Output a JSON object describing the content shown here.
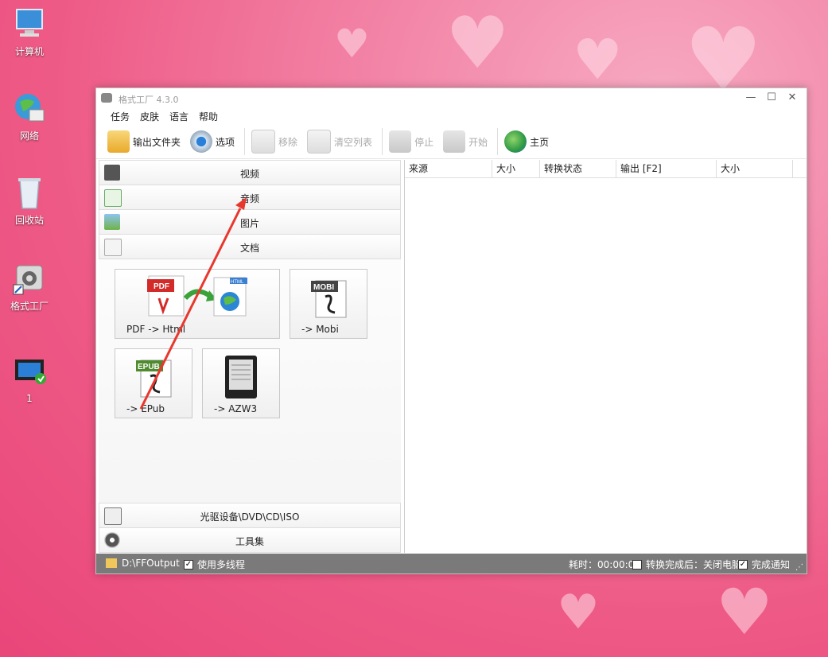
{
  "desktop": {
    "icons": [
      {
        "label": "计算机"
      },
      {
        "label": "网络"
      },
      {
        "label": "回收站"
      },
      {
        "label": "格式工厂"
      },
      {
        "label": "1"
      }
    ]
  },
  "window": {
    "title": "格式工厂 4.3.0",
    "menu": [
      "任务",
      "皮肤",
      "语言",
      "帮助"
    ],
    "toolbar": {
      "output_folder": "输出文件夹",
      "options": "选项",
      "remove": "移除",
      "clear_list": "清空列表",
      "stop": "停止",
      "start": "开始",
      "home": "主页"
    },
    "categories": {
      "video": "视频",
      "audio": "音频",
      "image": "图片",
      "document": "文档",
      "optical": "光驱设备\\DVD\\CD\\ISO",
      "tools": "工具集"
    },
    "tiles": [
      {
        "label": "PDF -> Html",
        "badge": "PDF",
        "badge2": "HTML"
      },
      {
        "label": "-> Mobi",
        "badge": "MOBI"
      },
      {
        "label": "-> EPub",
        "badge": "EPUB"
      },
      {
        "label": "-> AZW3"
      }
    ],
    "columns": [
      "来源",
      "大小",
      "转换状态",
      "输出 [F2]",
      "大小"
    ],
    "status": {
      "output_path": "D:\\FFOutput",
      "multithread": "使用多线程",
      "elapsed": "耗时：00:00:00",
      "after_done": "转换完成后：关闭电脑",
      "notify": "完成通知"
    }
  },
  "colors": {
    "annotation_arrow": "#e8382e",
    "status_bar": "#7a7a7a"
  }
}
